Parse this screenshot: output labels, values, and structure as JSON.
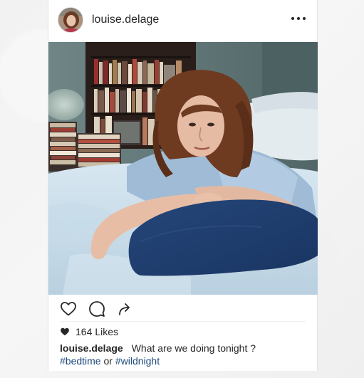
{
  "post": {
    "username": "louise.delage",
    "likes_count": "164",
    "likes_label": "Likes",
    "caption_user": "louise.delage",
    "caption_text": "What are we doing tonight ?",
    "hashtags": [
      "#bedtime",
      "#wildnight"
    ],
    "hashtag_joiner": "or"
  },
  "icons": {
    "more": "more-horizontal-icon",
    "like": "heart-outline-icon",
    "comment": "comment-icon",
    "share": "share-arrow-icon",
    "likes_heart": "heart-filled-icon"
  },
  "colors": {
    "text": "#262626",
    "hashtag": "#1c4a7c",
    "card_bg": "#ffffff",
    "page_bg": "#f4f4f4"
  }
}
